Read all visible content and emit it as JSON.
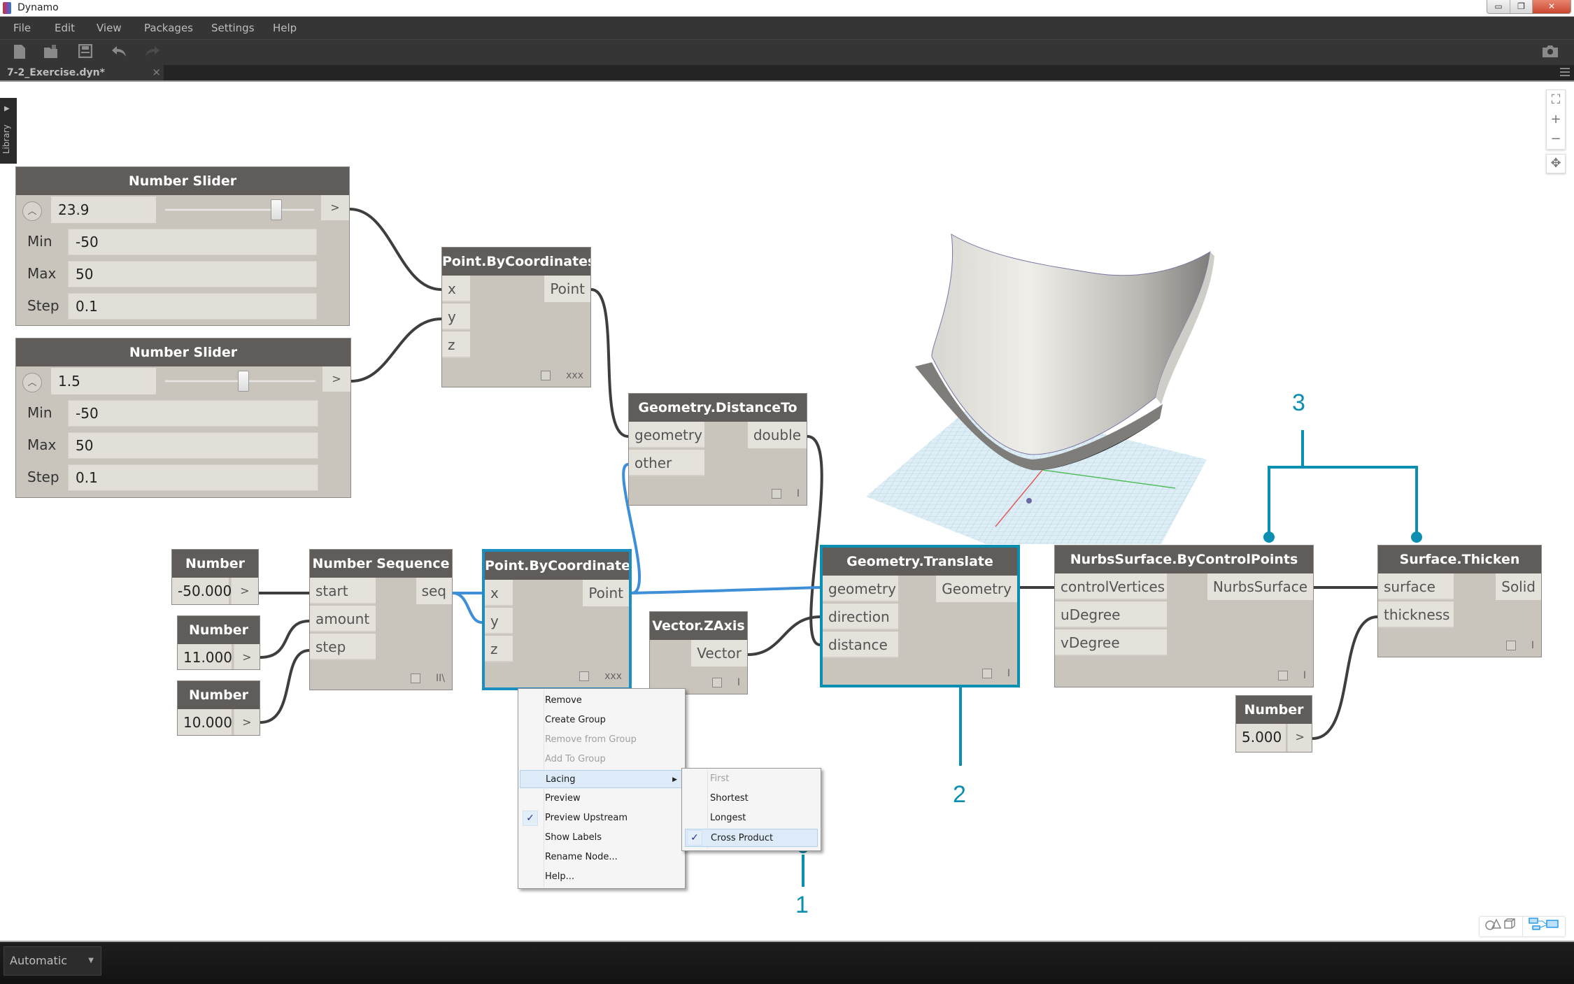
{
  "window": {
    "title": "Dynamo",
    "controls": [
      "minimize",
      "restore",
      "close"
    ]
  },
  "menubar": {
    "items": [
      {
        "label": "File"
      },
      {
        "label": "Edit"
      },
      {
        "label": "View"
      },
      {
        "label": "Packages"
      },
      {
        "label": "Settings"
      },
      {
        "label": "Help"
      }
    ]
  },
  "toolbar": {
    "buttons": [
      "new-file-icon",
      "open-folder-icon",
      "save-icon",
      "undo-icon",
      "redo-icon"
    ],
    "screenshot": "camera-icon"
  },
  "tabs": [
    {
      "label": "7-2_Exercise.dyn*",
      "close": "×"
    }
  ],
  "library": {
    "label": "Library"
  },
  "canvas_controls": {
    "fit": "⛶",
    "zoom_in": "+",
    "zoom_out": "−",
    "pan": "✥"
  },
  "nodes": {
    "slider1": {
      "title": "Number Slider",
      "value": "23.9",
      "fraction": 0.739,
      "min_label": "Min",
      "min": "-50",
      "max_label": "Max",
      "max": "50",
      "step_label": "Step",
      "step": "0.1",
      "out": ">"
    },
    "slider2": {
      "title": "Number Slider",
      "value": "1.5",
      "fraction": 0.515,
      "min_label": "Min",
      "min": "-50",
      "max_label": "Max",
      "max": "50",
      "step_label": "Step",
      "step": "0.1",
      "out": ">"
    },
    "pbc_top": {
      "title": "Point.ByCoordinates",
      "inputs": [
        "x",
        "y",
        "z"
      ],
      "output": "Point",
      "lacing": "xxx"
    },
    "distance_to": {
      "title": "Geometry.DistanceTo",
      "inputs": [
        "geometry",
        "other"
      ],
      "output": "double",
      "lacing": "I"
    },
    "number_start": {
      "title": "Number",
      "value": "-50.000",
      "out": ">"
    },
    "number_amount": {
      "title": "Number",
      "value": "11.000",
      "out": ">"
    },
    "number_step": {
      "title": "Number",
      "value": "10.000",
      "out": ">"
    },
    "number_sequence": {
      "title": "Number Sequence",
      "inputs": [
        "start",
        "amount",
        "step"
      ],
      "output": "seq",
      "lacing": "II\\"
    },
    "pbc_selected": {
      "title": "Point.ByCoordinates",
      "inputs": [
        "x",
        "y",
        "z"
      ],
      "output": "Point",
      "lacing": "xxx"
    },
    "vector_zaxis": {
      "title": "Vector.ZAxis",
      "output": "Vector",
      "lacing": "I"
    },
    "translate": {
      "title": "Geometry.Translate",
      "inputs": [
        "geometry",
        "direction",
        "distance"
      ],
      "output": "Geometry",
      "lacing": "I"
    },
    "nurbs": {
      "title": "NurbsSurface.ByControlPoints",
      "inputs": [
        "controlVertices",
        "uDegree",
        "vDegree"
      ],
      "output": "NurbsSurface",
      "lacing": "I"
    },
    "thicken": {
      "title": "Surface.Thicken",
      "inputs": [
        "surface",
        "thickness"
      ],
      "output": "Solid",
      "lacing": "I"
    },
    "number_thickness": {
      "title": "Number",
      "value": "5.000",
      "out": ">"
    }
  },
  "context_menu": {
    "items": [
      {
        "label": "Remove",
        "enabled": true
      },
      {
        "label": "Create Group",
        "enabled": true
      },
      {
        "label": "Remove from Group",
        "enabled": false
      },
      {
        "label": "Add To Group",
        "enabled": false
      },
      {
        "label": "Lacing",
        "enabled": true,
        "submenu": true,
        "highlighted": true
      },
      {
        "label": "Preview",
        "enabled": true
      },
      {
        "label": "Preview Upstream",
        "enabled": true,
        "checked": true
      },
      {
        "label": "Show Labels",
        "enabled": true
      },
      {
        "label": "Rename Node...",
        "enabled": true
      },
      {
        "label": "Help...",
        "enabled": true
      }
    ],
    "lacing_submenu": [
      {
        "label": "First",
        "enabled": false
      },
      {
        "label": "Shortest",
        "enabled": true
      },
      {
        "label": "Longest",
        "enabled": true
      },
      {
        "label": "Cross Product",
        "enabled": true,
        "checked": true
      }
    ],
    "check_glyph": "✓",
    "arrow_glyph": "▶"
  },
  "annotations": {
    "one": "1",
    "two": "2",
    "three": "3",
    "color": "#0b8fb0"
  },
  "bottombar": {
    "run_mode": "Automatic"
  },
  "view_toggle": {
    "geometry_view": "geometry-view-icon",
    "graph_view": "graph-view-icon"
  },
  "colors": {
    "wire": "#3e3e3e",
    "selected_wire": "#3e8fd8",
    "selected_border": "#1a8fbf",
    "node_header": "#5f5c59",
    "node_body": "#c9c5bd"
  }
}
